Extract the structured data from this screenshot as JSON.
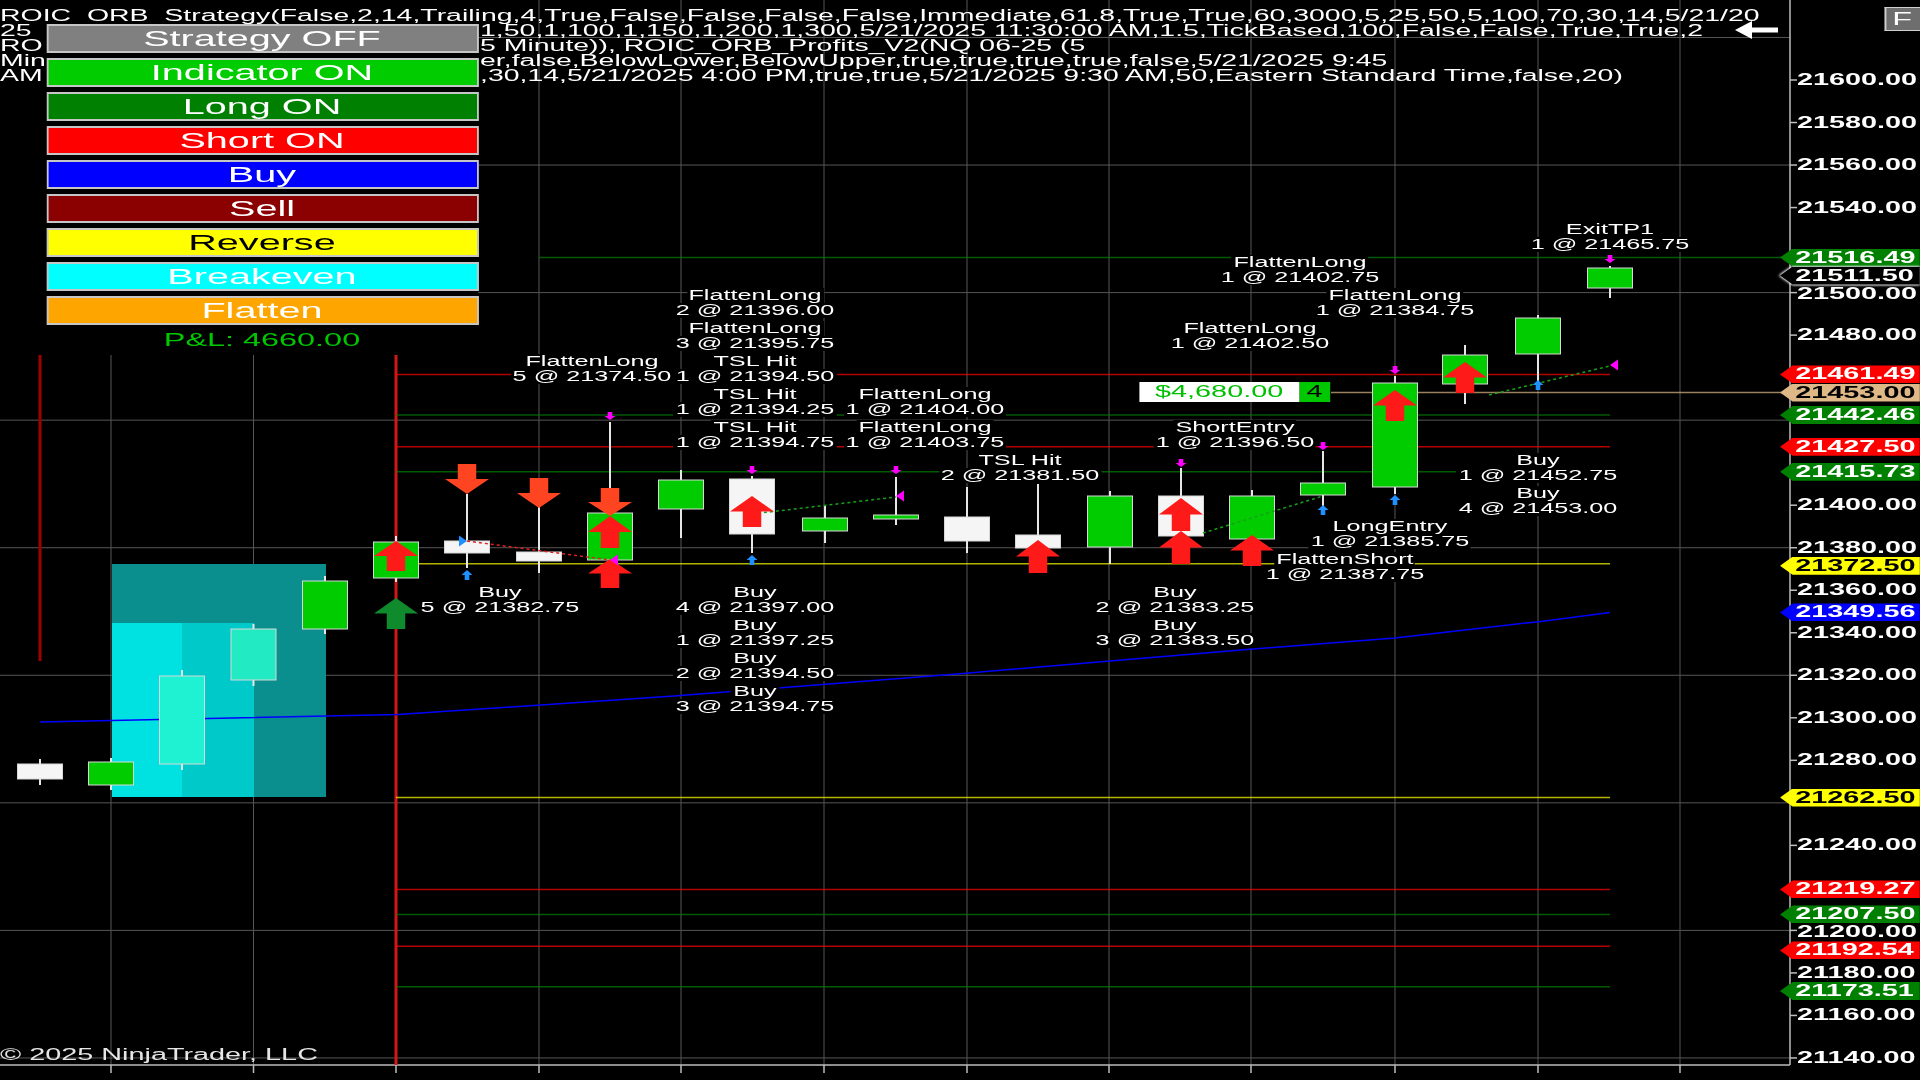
{
  "header": {
    "lines": [
      {
        "segments": [
          "ROIC  ORB  Strategy(False,2,14,Trailing,4,True,False,False,False,False,Immediate,61.8,True,True,60,3000,5,25,50,5,100,70,30,14,5/21/20"
        ]
      },
      {
        "segments": [
          "25",
          "1,50,1,100,1,150,1,200,1,300,5/21/2025 11:30:00 AM,1.5,TickBased,100,False,False,True,True,2"
        ]
      },
      {
        "segments": [
          "RO",
          "5 Minute)), ROIC_ORB_Profits_V2(NQ 06-25 (5"
        ]
      },
      {
        "segments": [
          "Min",
          "er,false,BelowLower,BelowUpper,true,true,true,true,false,5/21/2025 9:45"
        ]
      },
      {
        "segments": [
          "AM",
          ",30,14,5/21/2025 4:00 PM,true,true,5/21/2025 9:30 AM,50,Eastern Standard Time,false,20)"
        ]
      }
    ]
  },
  "toolbar_button": "F",
  "panel": {
    "buttons": [
      {
        "label": "Strategy OFF",
        "color": "#808080"
      },
      {
        "label": "Indicator ON",
        "color": "#00cc00"
      },
      {
        "label": "Long ON",
        "color": "#008000"
      },
      {
        "label": "Short ON",
        "color": "#ff0000"
      },
      {
        "label": "Buy",
        "color": "#0000ff"
      },
      {
        "label": "Sell",
        "color": "#8b0000"
      },
      {
        "label": "Reverse",
        "color": "#ffff00"
      },
      {
        "label": "Breakeven",
        "color": "#00ffff"
      },
      {
        "label": "Flatten",
        "color": "#ffa500"
      }
    ],
    "pnl": "P&L: 4660.00"
  },
  "trade_labels": [
    {
      "action": "ExitTP1",
      "fill": "1 @ 21465.75"
    },
    {
      "action": "FlattenLong",
      "fill": "1 @ 21402.75"
    },
    {
      "action": "FlattenLong",
      "fill": "2 @ 21396.00"
    },
    {
      "action": "FlattenLong",
      "fill": "1 @ 21384.75"
    },
    {
      "action": "FlattenLong",
      "fill": "3 @ 21395.75"
    },
    {
      "action": "FlattenLong",
      "fill": "1 @ 21402.50"
    },
    {
      "action": "FlattenLong",
      "fill": "5 @ 21374.50"
    },
    {
      "action": "TSL Hit",
      "fill": "1 @ 21394.50"
    },
    {
      "action": "TSL Hit",
      "fill": "1 @ 21394.25"
    },
    {
      "action": "FlattenLong",
      "fill": "1 @ 21404.00"
    },
    {
      "action": "TSL Hit",
      "fill": "1 @ 21394.75"
    },
    {
      "action": "FlattenLong",
      "fill": "1 @ 21403.75"
    },
    {
      "action": "ShortEntry",
      "fill": "1 @ 21396.50"
    },
    {
      "action": "TSL Hit",
      "fill": "2 @ 21381.50"
    },
    {
      "action": "Buy",
      "fill": "1 @ 21452.75"
    },
    {
      "action": "Buy",
      "fill": "4 @ 21453.00"
    },
    {
      "action": "LongEntry",
      "fill": "1 @ 21385.75"
    },
    {
      "action": "FlattenShort",
      "fill": "1 @ 21387.75"
    },
    {
      "action": "Buy",
      "fill": "5 @ 21382.75"
    },
    {
      "action": "Buy",
      "fill": "4 @ 21397.00"
    },
    {
      "action": "Buy",
      "fill": "2 @ 21383.25"
    },
    {
      "action": "Buy",
      "fill": "1 @ 21397.25"
    },
    {
      "action": "Buy",
      "fill": "3 @ 21383.50"
    },
    {
      "action": "Buy",
      "fill": "2 @ 21394.50"
    },
    {
      "action": "Buy",
      "fill": "3 @ 21394.75"
    }
  ],
  "position": {
    "pnl": "$4,680.00",
    "quantity": "4"
  },
  "price_axis": {
    "ticks": [
      "21600.00",
      "21580.00",
      "21560.00",
      "21540.00",
      "21500.00",
      "21480.00",
      "21400.00",
      "21380.00",
      "21360.00",
      "21340.00",
      "21320.00",
      "21300.00",
      "21280.00",
      "21240.00",
      "21200.00",
      "21180.00",
      "21160.00",
      "21140.00"
    ],
    "markers": [
      {
        "price": "21516.49",
        "color": "#008000",
        "outlined": false
      },
      {
        "price": "21511.50",
        "color": "#000000",
        "outlined": true
      },
      {
        "price": "21461.49",
        "color": "#ff0000",
        "outlined": false
      },
      {
        "price": "21453.00",
        "color": "#deb887",
        "outlined": false
      },
      {
        "price": "21442.46",
        "color": "#008000",
        "outlined": false
      },
      {
        "price": "21427.50",
        "color": "#ff0000",
        "outlined": false
      },
      {
        "price": "21415.73",
        "color": "#008000",
        "outlined": false
      },
      {
        "price": "21372.50",
        "color": "#ffff00",
        "outlined": false
      },
      {
        "price": "21349.56",
        "color": "#0000ff",
        "outlined": false
      },
      {
        "price": "21262.50",
        "color": "#ffff00",
        "outlined": false
      },
      {
        "price": "21219.27",
        "color": "#ff0000",
        "outlined": false
      },
      {
        "price": "21207.50",
        "color": "#008000",
        "outlined": false
      },
      {
        "price": "21192.54",
        "color": "#ff0000",
        "outlined": false
      },
      {
        "price": "21173.51",
        "color": "#008000",
        "outlined": false
      }
    ]
  },
  "copyright": "© 2025 NinjaTrader, LLC"
}
